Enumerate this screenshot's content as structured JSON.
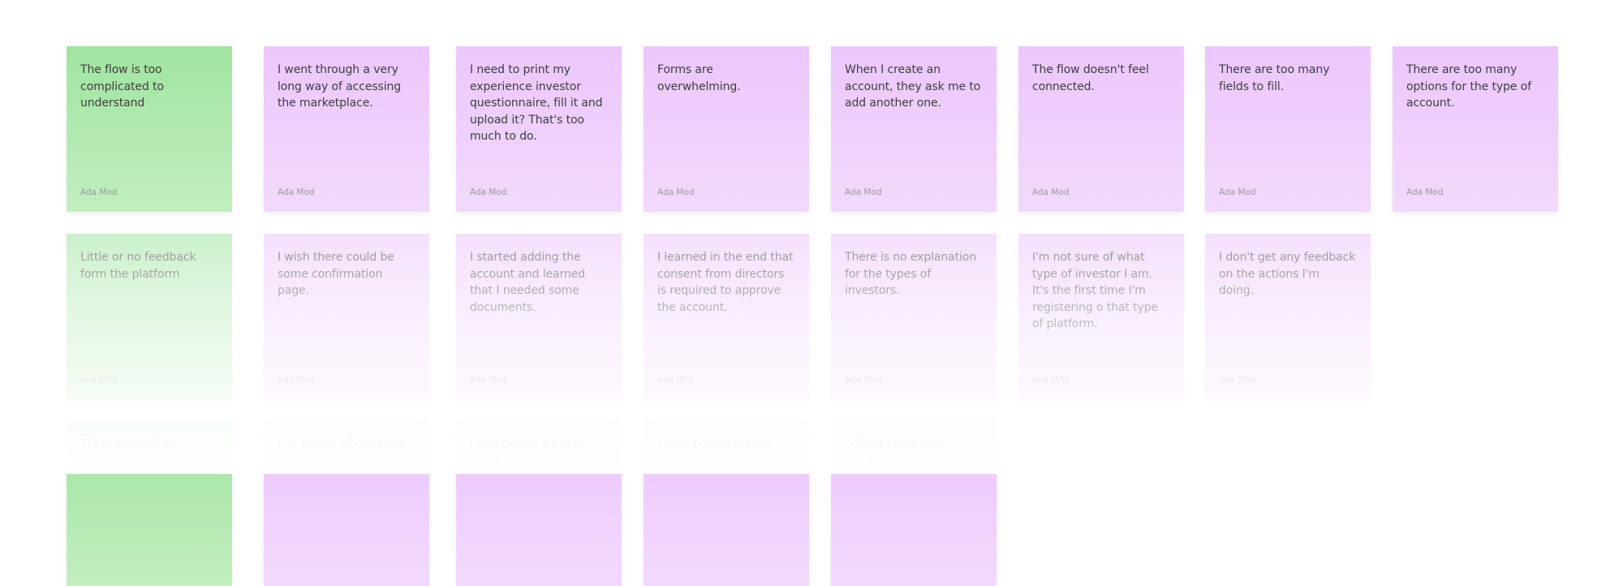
{
  "board": {
    "colors": {
      "green": "#a0e4a0",
      "purple": "#ecc6fc"
    },
    "rows": [
      [
        {
          "text": "The flow is too complicated to understand",
          "author": "Ada Mod",
          "color": "green"
        },
        {
          "text": "I went through a very long way of accessing the marketplace.",
          "author": "Ada Mod",
          "color": "purple"
        },
        {
          "text": "I need to print my experience investor questionnaire, fill it and upload it? That's too much to do.",
          "author": "Ada Mod",
          "color": "purple"
        },
        {
          "text": "Forms are overwhelming.",
          "author": "Ada Mod",
          "color": "purple"
        },
        {
          "text": "When I create an account, they ask me to add another one.",
          "author": "Ada Mod",
          "color": "purple"
        },
        {
          "text": "The flow doesn't feel connected.",
          "author": "Ada Mod",
          "color": "purple"
        },
        {
          "text": "There are too many fields to fill.",
          "author": "Ada Mod",
          "color": "purple"
        },
        {
          "text": "There are too many options for the type of account.",
          "author": "Ada Mod",
          "color": "purple"
        }
      ],
      [
        {
          "text": "Little or no feedback form the platform",
          "author": "Ada Mod",
          "color": "green"
        },
        {
          "text": "I wish there could be some confirmation page.",
          "author": "Ada Mod",
          "color": "purple"
        },
        {
          "text": "I started adding the account and learned that I needed some documents.",
          "author": "Ada Mod",
          "color": "purple"
        },
        {
          "text": "I learned in the end that consent from directors is required to approve the account.",
          "author": "Ada Mod",
          "color": "purple"
        },
        {
          "text": "There is no explanation for the types of investors.",
          "author": "Ada Mod",
          "color": "purple"
        },
        {
          "text": "I'm not sure of what type of investor I am. It's the first time I'm registering o that type of platform.",
          "author": "Ada Mod",
          "color": "purple"
        },
        {
          "text": "I don't get any feedback on the actions I'm doing.",
          "author": "Ada Mod",
          "color": "purple"
        }
      ],
      [
        {
          "text": "There is no clear statement of",
          "author": "",
          "color": "green"
        },
        {
          "text": "I've added all directors",
          "author": "",
          "color": "purple"
        },
        {
          "text": "I don't know what to count",
          "author": "",
          "color": "purple"
        },
        {
          "text": "I wish I could review some",
          "author": "",
          "color": "purple"
        },
        {
          "text": "I didn't know that I needed",
          "author": "",
          "color": "purple"
        }
      ]
    ]
  }
}
